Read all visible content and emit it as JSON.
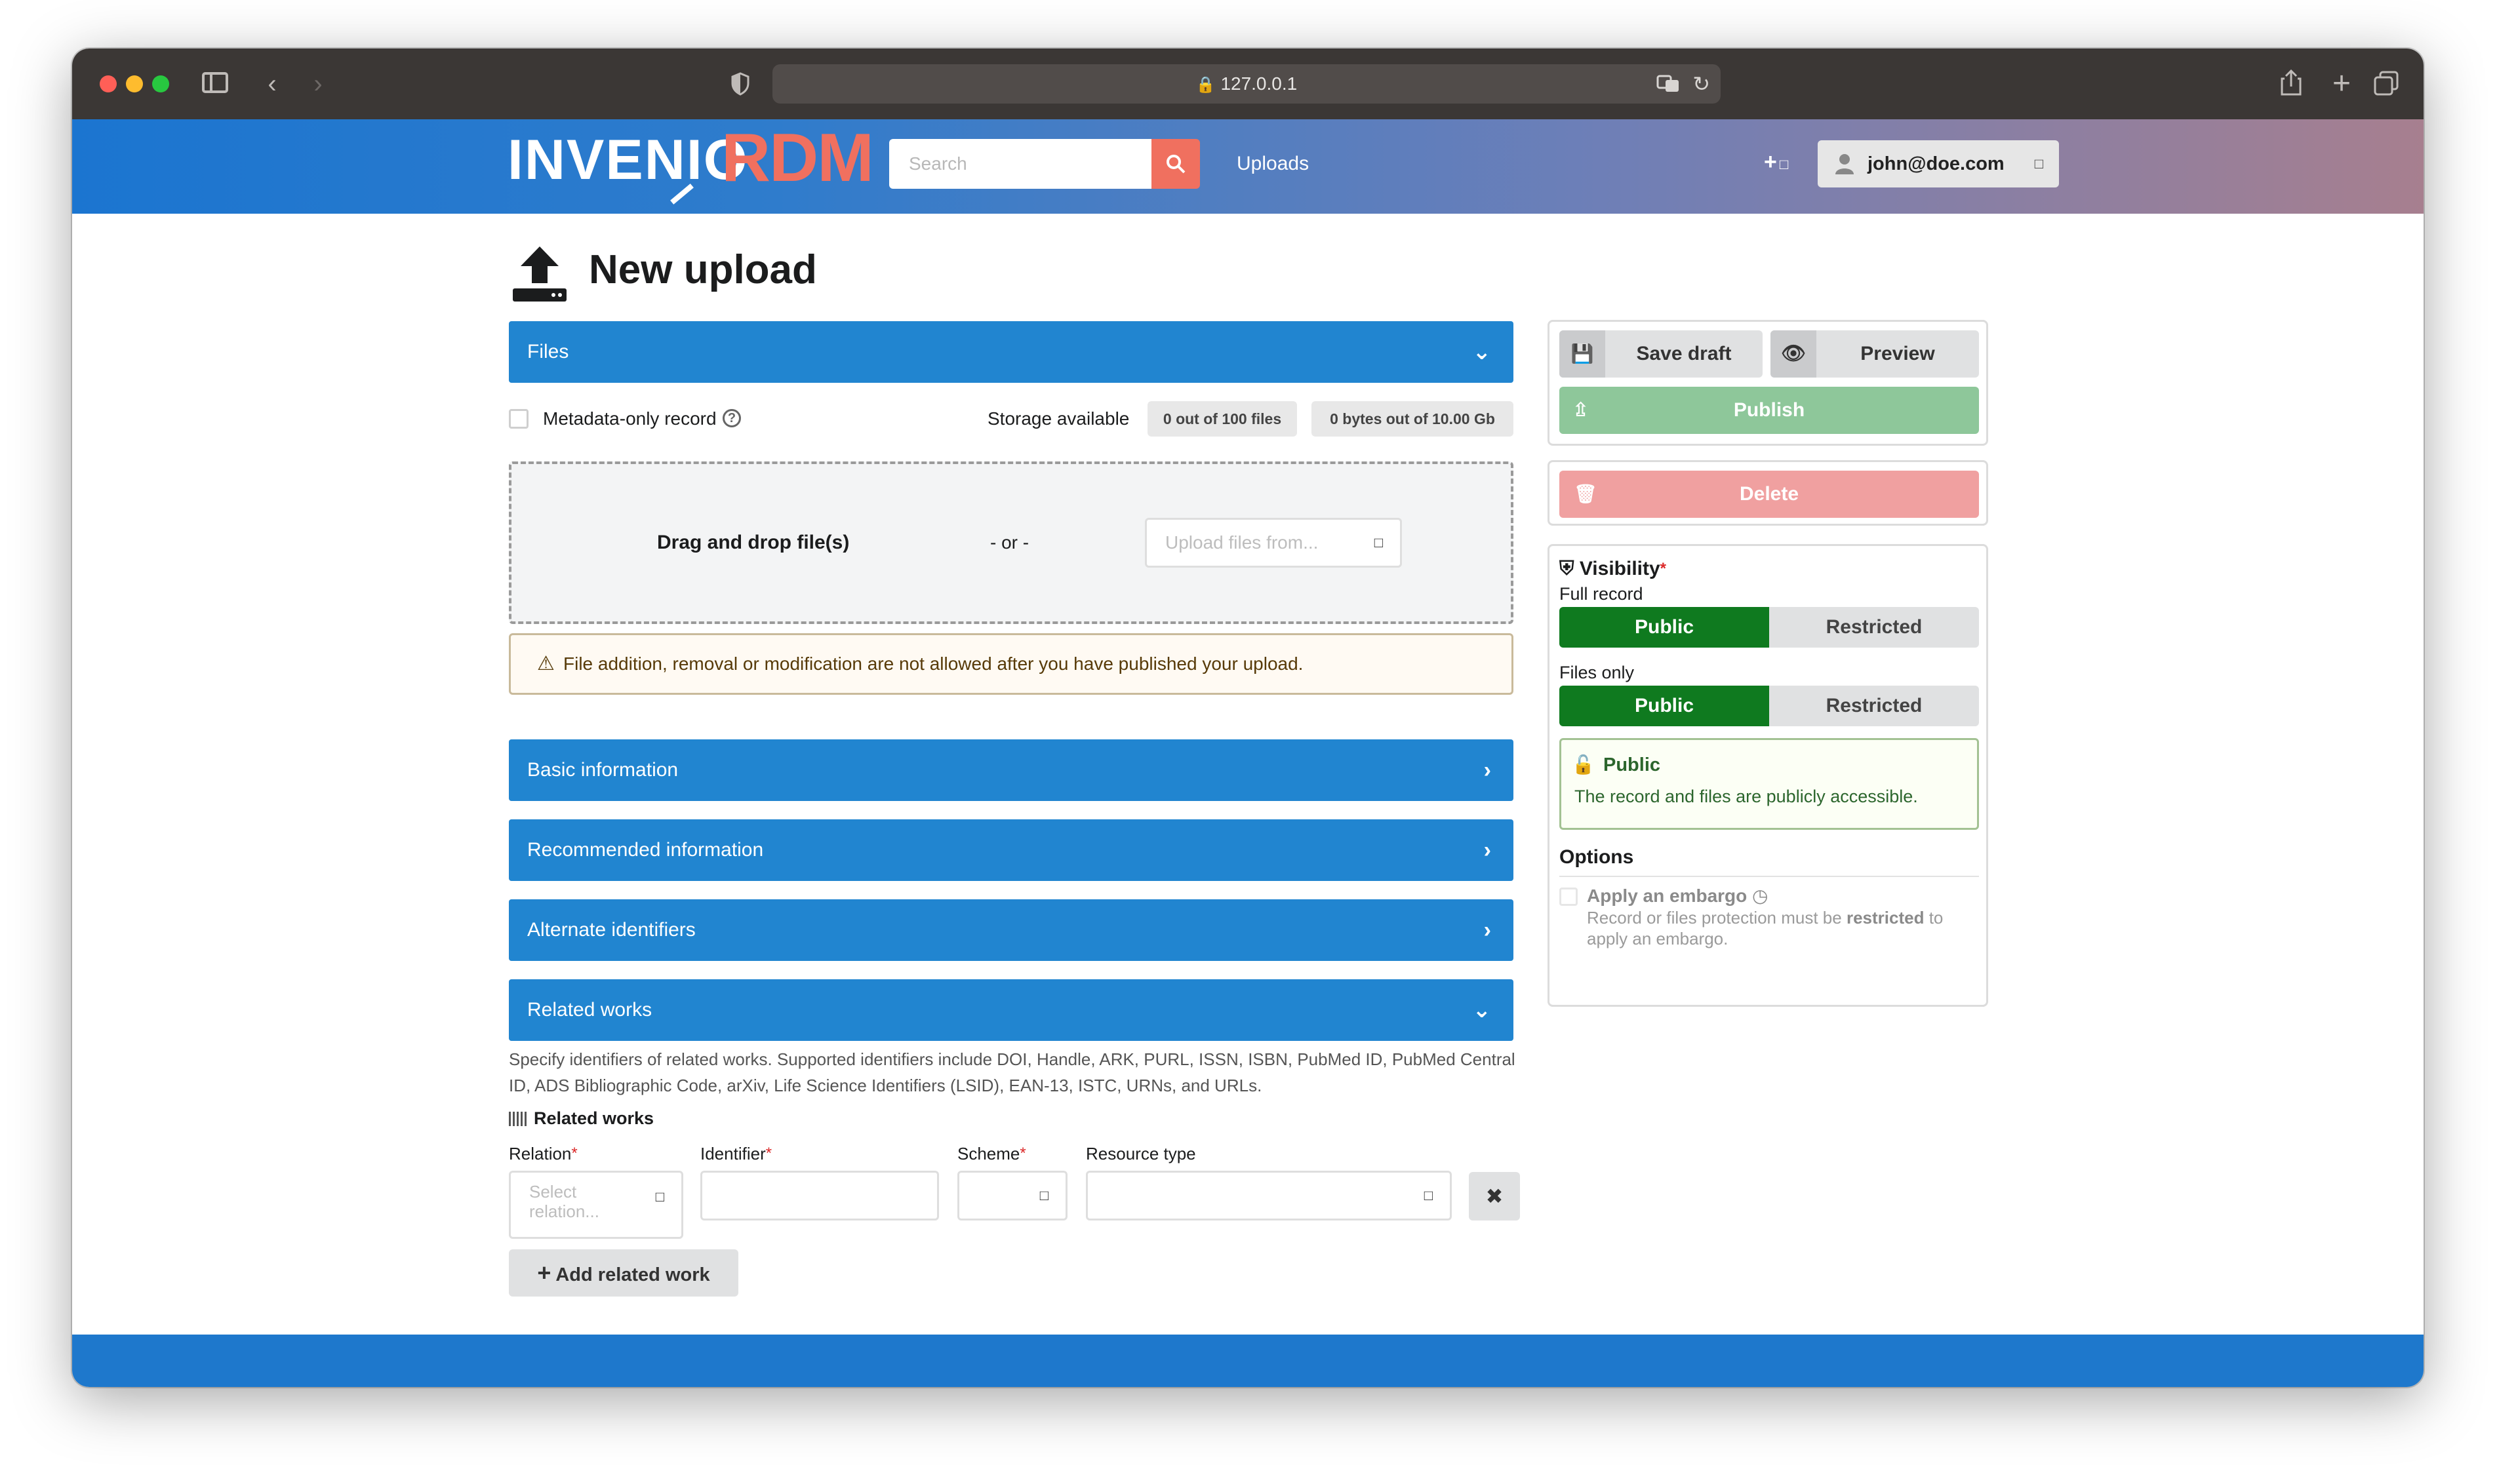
{
  "browser": {
    "url": "127.0.0.1"
  },
  "nav": {
    "logo_left": "INVENIO",
    "logo_right": "RDM",
    "search_placeholder": "Search",
    "uploads_label": "Uploads",
    "plus_label": "+",
    "user_label": "john@doe.com"
  },
  "page": {
    "title": "New upload"
  },
  "files": {
    "header": "Files",
    "metadata_only_label": "Metadata-only record",
    "storage_label": "Storage available",
    "files_count": "0 out of 100 files",
    "bytes_count": "0 bytes out of 10.00 Gb",
    "drag_drop_label": "Drag and drop file(s)",
    "or_label": "- or -",
    "upload_from_placeholder": "Upload files from...",
    "warning_text": "File addition, removal or modification are not allowed after you have published your upload."
  },
  "sections": {
    "basic": "Basic information",
    "recommended": "Recommended information",
    "alternate": "Alternate identifiers",
    "related": "Related works"
  },
  "related_works": {
    "description": "Specify identifiers of related works. Supported identifiers include DOI, Handle, ARK, PURL, ISSN, ISBN, PubMed ID, PubMed Central ID, ADS Bibliographic Code, arXiv, Life Science Identifiers (LSID), EAN-13, ISTC, URNs, and URLs.",
    "subheader": "Related works",
    "relation_label": "Relation",
    "identifier_label": "Identifier",
    "scheme_label": "Scheme",
    "resource_type_label": "Resource type",
    "relation_placeholder": "Select relation...",
    "add_label": "Add related work",
    "required_mark": "*"
  },
  "sidebar": {
    "save_draft": "Save draft",
    "preview": "Preview",
    "publish": "Publish",
    "delete": "Delete",
    "visibility_title": "Visibility",
    "full_record_label": "Full record",
    "files_only_label": "Files only",
    "public": "Public",
    "restricted": "Restricted",
    "info_title": "Public",
    "info_text": "The record and files are publicly accessible.",
    "options_title": "Options",
    "embargo_label": "Apply an embargo",
    "embargo_help_1": "Record or files protection must be",
    "embargo_help_bold": "restricted",
    "embargo_help_2": "to",
    "embargo_help_3": "apply an embargo."
  },
  "colors": {
    "primary": "#2185d0",
    "accent": "#f0705f",
    "public_green": "#0f7a1f",
    "publish_green": "#8ec79a",
    "delete_red": "#f0a0a0"
  }
}
